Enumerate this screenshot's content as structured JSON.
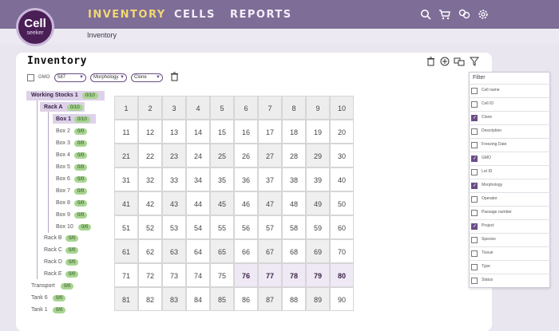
{
  "header": {
    "logo_line1": "Cell",
    "logo_line2": "seeker",
    "nav": [
      "INVENTORY",
      "CELLS",
      "REPORTS"
    ],
    "breadcrumb": "Inventory",
    "icons": [
      "search-icon",
      "cart-icon",
      "users-icon",
      "gear-icon"
    ]
  },
  "page": {
    "title": "Inventory"
  },
  "toolbar": {
    "gmo_label": "GMO",
    "select1": "587",
    "select2": "Morphology",
    "select3": "Clone"
  },
  "tree": {
    "working_stocks": {
      "label": "Working Stocks 1",
      "badge": "0/10"
    },
    "rack_a": {
      "label": "Rack A",
      "badge": "0/10"
    },
    "boxes": [
      {
        "label": "Box 1",
        "badge": "0/10"
      },
      {
        "label": "Box 2",
        "badge": "0/0"
      },
      {
        "label": "Box 3",
        "badge": "0/0"
      },
      {
        "label": "Box 4",
        "badge": "0/0"
      },
      {
        "label": "Box 5",
        "badge": "0/0"
      },
      {
        "label": "Box 6",
        "badge": "0/0"
      },
      {
        "label": "Box 7",
        "badge": "0/0"
      },
      {
        "label": "Box 8",
        "badge": "0/0"
      },
      {
        "label": "Box 9",
        "badge": "0/0"
      },
      {
        "label": "Box 10",
        "badge": "0/0"
      }
    ],
    "racks": [
      {
        "label": "Rack B",
        "badge": "0/0"
      },
      {
        "label": "Rack C",
        "badge": "0/0"
      },
      {
        "label": "Rack D",
        "badge": "0/0"
      },
      {
        "label": "Rack E",
        "badge": "0/0"
      }
    ],
    "others": [
      {
        "label": "Transport",
        "badge": "0/0"
      },
      {
        "label": "Tank 6",
        "badge": "0/0"
      },
      {
        "label": "Tank 1",
        "badge": "0/0"
      }
    ]
  },
  "grid": {
    "rows": [
      [
        "1",
        "2",
        "3",
        "4",
        "5",
        "6",
        "7",
        "8",
        "9",
        "10"
      ],
      [
        "11",
        "12",
        "13",
        "14",
        "15",
        "16",
        "17",
        "18",
        "19",
        "20"
      ],
      [
        "21",
        "22",
        "23",
        "24",
        "25",
        "26",
        "27",
        "28",
        "29",
        "30"
      ],
      [
        "31",
        "32",
        "33",
        "34",
        "35",
        "36",
        "37",
        "38",
        "39",
        "40"
      ],
      [
        "41",
        "42",
        "43",
        "44",
        "45",
        "46",
        "47",
        "48",
        "49",
        "50"
      ],
      [
        "51",
        "52",
        "53",
        "54",
        "55",
        "56",
        "57",
        "58",
        "59",
        "60"
      ],
      [
        "61",
        "62",
        "63",
        "64",
        "65",
        "66",
        "67",
        "68",
        "69",
        "70"
      ],
      [
        "71",
        "72",
        "73",
        "74",
        "75",
        "76",
        "77",
        "78",
        "79",
        "80"
      ],
      [
        "81",
        "82",
        "83",
        "84",
        "85",
        "86",
        "87",
        "88",
        "89",
        "90"
      ]
    ],
    "highlighted": [
      "76",
      "77",
      "78",
      "79",
      "80"
    ]
  },
  "filter": {
    "title": "Filter",
    "items": [
      {
        "label": "Cell name",
        "checked": false
      },
      {
        "label": "Cell ID",
        "checked": false
      },
      {
        "label": "Clone",
        "checked": true
      },
      {
        "label": "Description",
        "checked": false
      },
      {
        "label": "Freezing Date",
        "checked": false
      },
      {
        "label": "GMO",
        "checked": true
      },
      {
        "label": "Lot ID",
        "checked": false
      },
      {
        "label": "Morphology",
        "checked": true
      },
      {
        "label": "Operator",
        "checked": false
      },
      {
        "label": "Passage number",
        "checked": false
      },
      {
        "label": "Project",
        "checked": true
      },
      {
        "label": "Species",
        "checked": false
      },
      {
        "label": "Tissue",
        "checked": false
      },
      {
        "label": "Type",
        "checked": false
      },
      {
        "label": "Status",
        "checked": false
      }
    ]
  },
  "colors": {
    "brand": "#7e6d97",
    "brand_dark": "#4a1f55",
    "accent": "#f1d873",
    "badge": "#a8d591"
  }
}
